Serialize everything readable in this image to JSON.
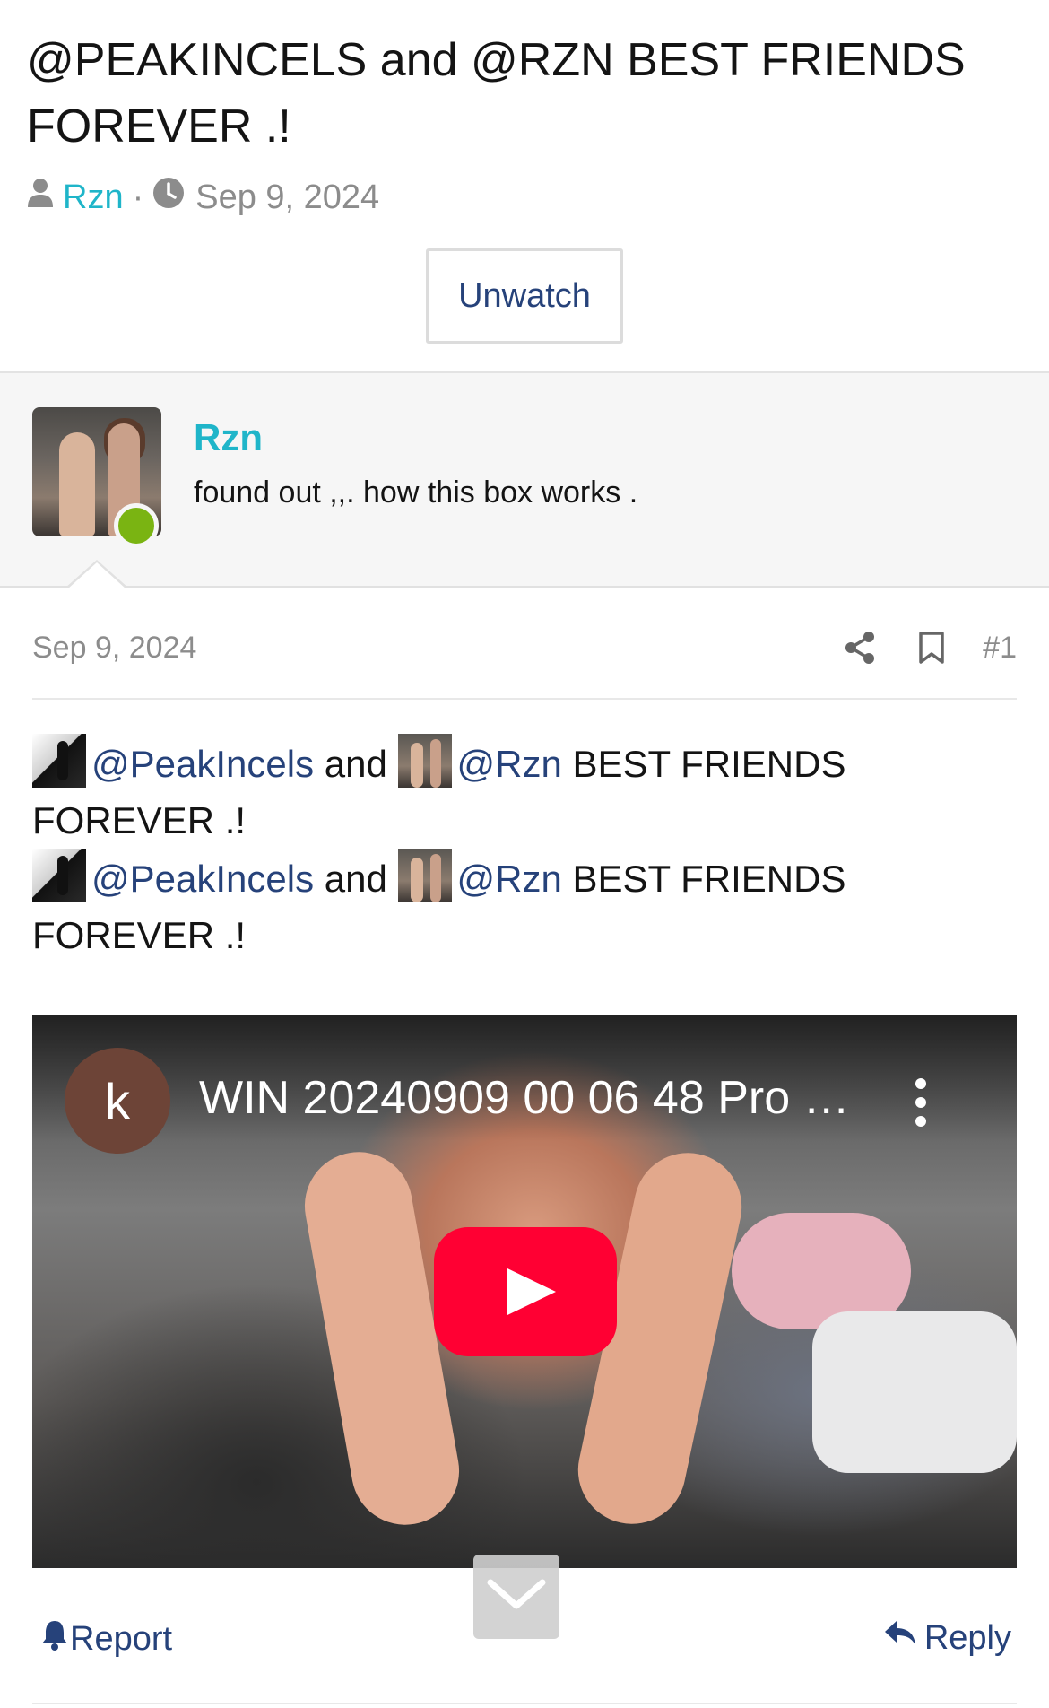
{
  "thread": {
    "title": "@PEAKINCELS and @RZN BEST FRIENDS FOREVER .!",
    "author": "Rzn",
    "separator": "·",
    "date": "Sep 9, 2024",
    "watch_label": "Unwatch"
  },
  "poster": {
    "name": "Rzn",
    "user_title": "found out ,,. how this box works .",
    "online_color": "#7ab412"
  },
  "post": {
    "date": "Sep 9, 2024",
    "number": "#1",
    "lines": [
      {
        "mention1": "@PeakIncels",
        "joiner": " and ",
        "mention2": "@Rzn",
        "rest": " BEST FRIENDS FOREVER .!"
      },
      {
        "mention1": "@PeakIncels",
        "joiner": " and ",
        "mention2": "@Rzn",
        "rest": " BEST FRIENDS FOREVER .!"
      }
    ],
    "report_label": "Report",
    "reply_label": "Reply"
  },
  "video": {
    "channel_initial": "k",
    "title": "WIN 20240909 00 06 48 Pro …",
    "play_color": "#ff0033"
  },
  "colors": {
    "accent_link": "#26427a",
    "username": "#1fb5c9",
    "muted": "#8c8c8c"
  },
  "icons": [
    "user-icon",
    "clock-icon",
    "share-icon",
    "bookmark-icon",
    "play-icon",
    "more-vertical-icon",
    "bell-icon",
    "reply-icon",
    "chevron-down-icon"
  ]
}
